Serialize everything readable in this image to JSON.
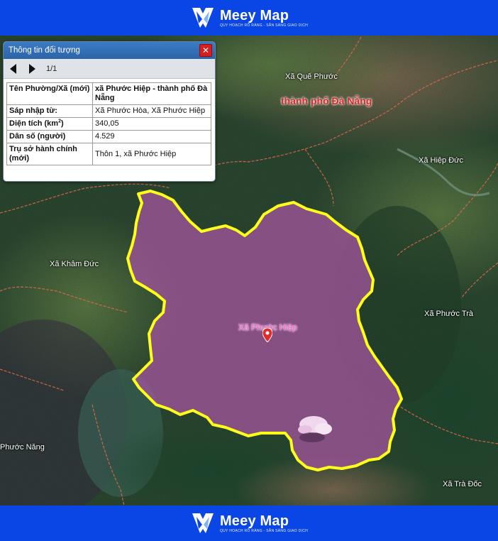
{
  "brand": {
    "name": "Meey Map",
    "tagline": "QUY HOẠCH RÕ RÀNG - SẴN SÀNG GIAO DỊCH"
  },
  "info_panel": {
    "title": "Thông tin đối tượng",
    "close_label": "✕",
    "pager": "1/1",
    "rows": [
      {
        "key": "Tên Phường/Xã (mới)",
        "value": "xã Phước Hiệp - thành phố Đà Nẵng"
      },
      {
        "key": "Sáp nhập từ:",
        "value": "Xã Phước Hòa, Xã Phước Hiệp"
      },
      {
        "key_main": "Diện tích (km",
        "key_sup": "2",
        "key_tail": ")",
        "value": "340,05"
      },
      {
        "key": "Dân số (người)",
        "value": "4.529"
      },
      {
        "key": "Trụ sở hành chính (mới)",
        "value": "Thôn 1, xã Phước Hiệp"
      }
    ]
  },
  "map": {
    "labels": {
      "que_phuoc": "Xã Quế Phước",
      "da_nang": "thành phố Đà Nẵng",
      "hiep_duc": "Xã Hiệp Đức",
      "kham_duc": "Xã Khâm Đức",
      "phuoc_tra": "Xã Phước Trà",
      "phuoc_hiep": "Xã Phước Hiệp",
      "phuoc_nang": "Phước Năng",
      "tra_doc": "Xã Trà Đốc"
    },
    "colors": {
      "highlight_fill": "#a0559a",
      "highlight_border": "#ffff1a",
      "boundary": "#e0674a",
      "city_label": "#d42a2a",
      "brand_blue": "#0a45e6"
    },
    "icons": {
      "marker": "map-pin-icon",
      "prev": "caret-left-icon",
      "next": "caret-right-icon",
      "close": "close-icon"
    }
  }
}
